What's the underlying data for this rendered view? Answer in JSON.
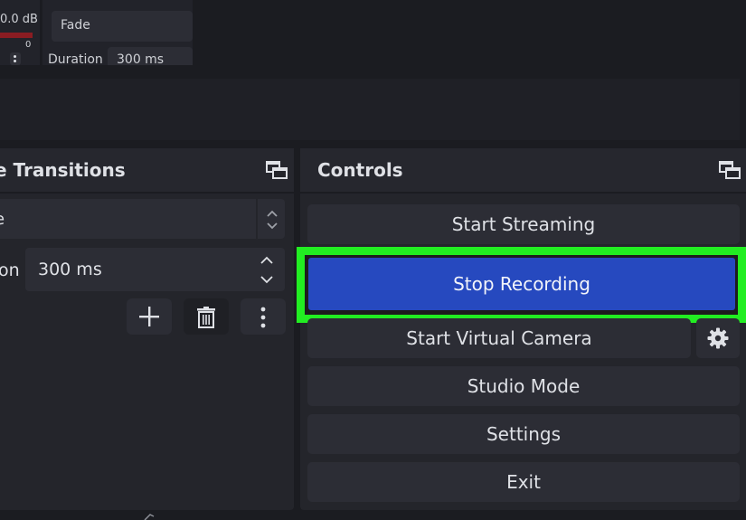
{
  "top_strip": {
    "db_value": "0.0 dB",
    "meter_zero": "0",
    "transition_type": "Fade",
    "duration_label": "Duration",
    "duration_value": "300 ms"
  },
  "transitions_panel": {
    "title": "e Transitions",
    "selected_transition": "e",
    "duration_label": "on",
    "duration_value": "300 ms"
  },
  "controls_panel": {
    "title": "Controls",
    "buttons": {
      "start_streaming": "Start Streaming",
      "stop_recording": "Stop Recording",
      "start_virtual_camera": "Start Virtual Camera",
      "studio_mode": "Studio Mode",
      "settings": "Settings",
      "exit": "Exit"
    }
  },
  "colors": {
    "background": "#1b1c21",
    "panel": "#24252b",
    "button": "#2c2d35",
    "stop_recording_active": "#2649bf",
    "highlight": "#22ee22",
    "meter_red": "#8a1c22"
  },
  "icons": [
    "undock-icon",
    "spin-arrows-icon",
    "add-icon",
    "trash-icon",
    "more-vertical-icon",
    "gear-icon"
  ]
}
